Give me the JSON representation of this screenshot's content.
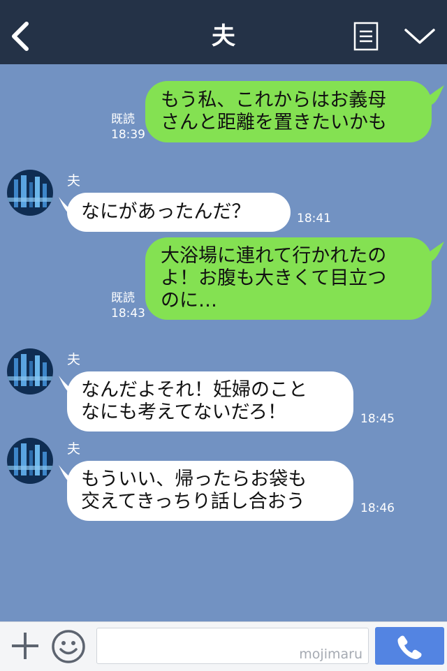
{
  "header": {
    "title": "夫",
    "back_icon": "chevron-left-icon",
    "menu_icon": "list-icon",
    "expand_icon": "chevron-down-icon",
    "background": "#243247"
  },
  "chat": {
    "background": "#7292c2",
    "contact_name": "夫",
    "messages": [
      {
        "from": "me",
        "lines": [
          "もう私、これからはお義母",
          "さんと距離を置きたいかも"
        ],
        "read": "既読",
        "time": "18:39"
      },
      {
        "from": "夫",
        "lines": [
          "なにがあったんだ？"
        ],
        "time": "18:41"
      },
      {
        "from": "me",
        "lines": [
          "大浴場に連れて行かれたの",
          "よ！お腹も大きくて目立つ",
          "のに…"
        ],
        "read": "既読",
        "time": "18:43"
      },
      {
        "from": "夫",
        "lines": [
          "なんだよそれ！妊婦のこと",
          "なにも考えてないだろ！"
        ],
        "time": "18:45"
      },
      {
        "from": "夫",
        "lines": [
          "もういい、帰ったらお袋も",
          "交えてきっちり話し合おう"
        ],
        "time": "18:46"
      }
    ]
  },
  "input_bar": {
    "plus_icon": "plus-icon",
    "sticker_icon": "smiley-icon",
    "watermark": "mojimaru",
    "call_icon": "phone-icon",
    "call_color": "#5384e2"
  },
  "colors": {
    "outgoing_bubble": "#84e152",
    "incoming_bubble": "#ffffff"
  }
}
